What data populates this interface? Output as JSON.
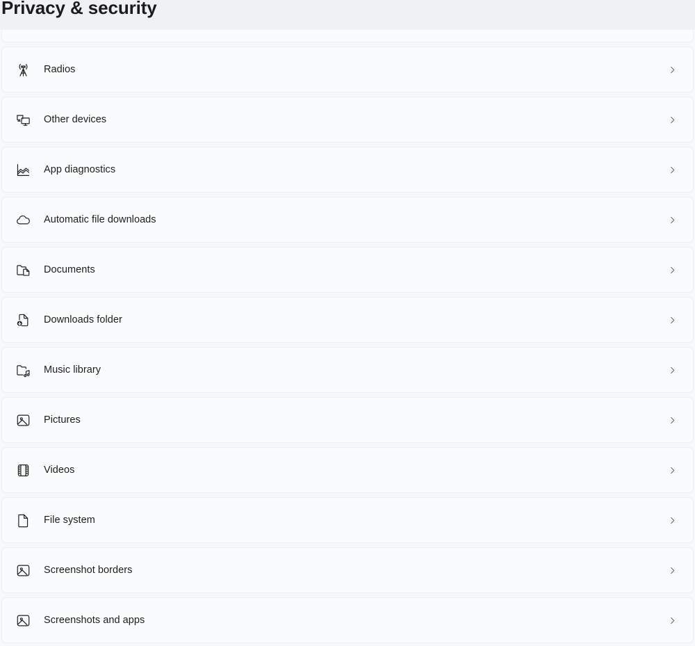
{
  "header": {
    "title": "Privacy & security"
  },
  "colors": {
    "header_background": "#eff1f5",
    "page_background": "#f7f8fa",
    "card_background": "#fafbfc",
    "card_border": "#ebedf0",
    "text_primary": "#1d1d1d",
    "icon": "#1f1f1f",
    "chevron": "#44464a"
  },
  "app_permissions": {
    "rows": [
      {
        "label": "Radios",
        "icon": "radio-tower-icon",
        "chevron": "chevron-right-icon"
      },
      {
        "label": "Other devices",
        "icon": "other-devices-icon",
        "chevron": "chevron-right-icon"
      },
      {
        "label": "App diagnostics",
        "icon": "app-diagnostics-icon",
        "chevron": "chevron-right-icon"
      },
      {
        "label": "Automatic file downloads",
        "icon": "cloud-icon",
        "chevron": "chevron-right-icon"
      },
      {
        "label": "Documents",
        "icon": "folder-document-icon",
        "chevron": "chevron-right-icon"
      },
      {
        "label": "Downloads folder",
        "icon": "document-download-icon",
        "chevron": "chevron-right-icon"
      },
      {
        "label": "Music library",
        "icon": "folder-music-icon",
        "chevron": "chevron-right-icon"
      },
      {
        "label": "Pictures",
        "icon": "picture-icon",
        "chevron": "chevron-right-icon"
      },
      {
        "label": "Videos",
        "icon": "film-strip-icon",
        "chevron": "chevron-right-icon"
      },
      {
        "label": "File system",
        "icon": "document-page-icon",
        "chevron": "chevron-right-icon"
      },
      {
        "label": "Screenshot borders",
        "icon": "picture-icon",
        "chevron": "chevron-right-icon"
      },
      {
        "label": "Screenshots and apps",
        "icon": "picture-icon",
        "chevron": "chevron-right-icon"
      }
    ]
  }
}
